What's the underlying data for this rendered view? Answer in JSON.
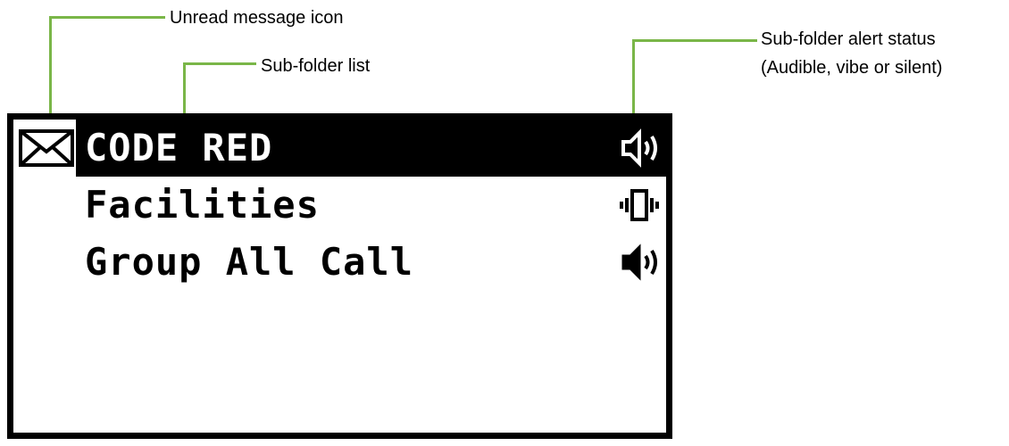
{
  "callouts": {
    "unread_message_icon": "Unread message icon",
    "subfolder_list": "Sub-folder list",
    "alert_status_line1": "Sub-folder alert status",
    "alert_status_line2": "(Audible, vibe or silent)"
  },
  "colors": {
    "leader_line": "#7ab648",
    "screen_border": "#000000",
    "highlight": "#000000"
  },
  "folders": [
    {
      "label": "CODE RED",
      "selected": true,
      "unread": true,
      "alert_icon": "speaker-audible-outline-icon"
    },
    {
      "label": "Facilities",
      "selected": false,
      "unread": false,
      "alert_icon": "vibrate-icon"
    },
    {
      "label": "Group All Call",
      "selected": false,
      "unread": false,
      "alert_icon": "speaker-audible-filled-icon"
    }
  ]
}
